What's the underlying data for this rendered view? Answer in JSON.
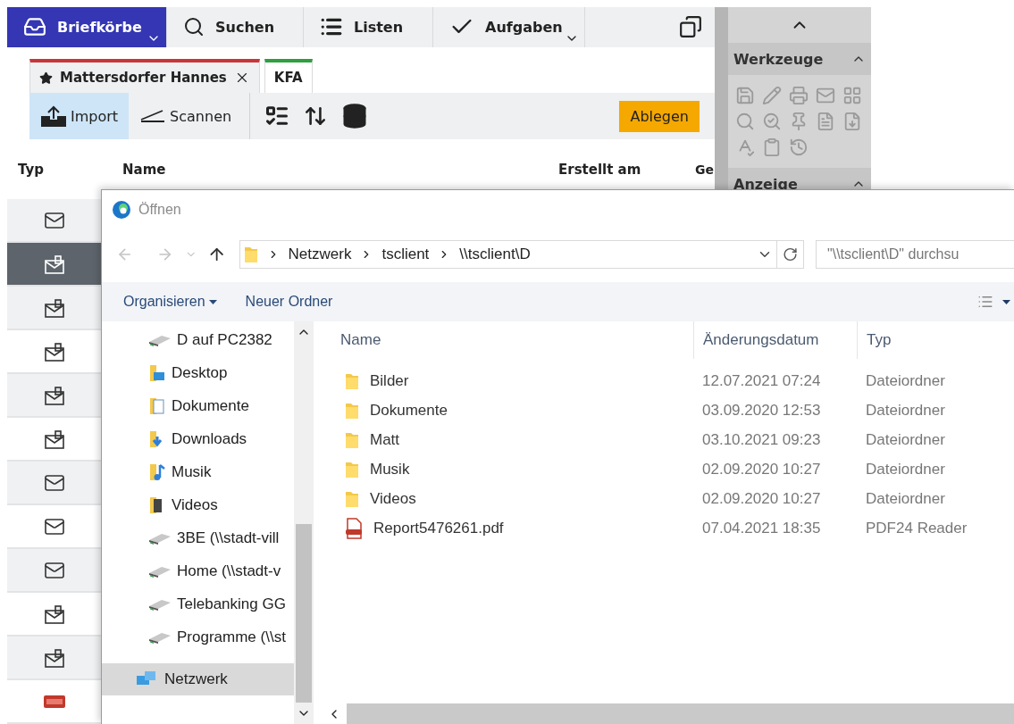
{
  "top_nav": {
    "items": [
      {
        "label": "Briefkörbe",
        "kind": "inbox",
        "dropdown": true,
        "selected": true
      },
      {
        "label": "Suchen",
        "kind": "search",
        "dropdown": false,
        "selected": false
      },
      {
        "label": "Listen",
        "kind": "list",
        "dropdown": false,
        "selected": false
      },
      {
        "label": "Aufgaben",
        "kind": "check",
        "dropdown": true,
        "selected": false
      }
    ]
  },
  "tabs": [
    {
      "label": "Mattersdorfer Hannes",
      "starred": true,
      "closable": true,
      "color": "#c8363a",
      "selected": true
    },
    {
      "label": "KFA",
      "starred": false,
      "closable": false,
      "color": "#2e9e3e",
      "selected": false
    }
  ],
  "toolbar": {
    "buttons": [
      {
        "label": "Import",
        "kind": "import",
        "selected": true
      },
      {
        "label": "Scannen",
        "kind": "scan",
        "selected": false
      }
    ],
    "primary": "Ablegen"
  },
  "table": {
    "columns": [
      "Typ",
      "Name",
      "Erstellt am",
      "Ge"
    ],
    "rows": [
      {
        "kind": "mail",
        "selected": false
      },
      {
        "kind": "attachment",
        "selected": true
      },
      {
        "kind": "attachment",
        "selected": false
      },
      {
        "kind": "attachment",
        "selected": false
      },
      {
        "kind": "attachment",
        "selected": false
      },
      {
        "kind": "attachment",
        "selected": false
      },
      {
        "kind": "mail",
        "selected": false
      },
      {
        "kind": "mail",
        "selected": false
      },
      {
        "kind": "mail",
        "selected": false
      },
      {
        "kind": "attachment",
        "selected": false
      },
      {
        "kind": "attachment",
        "selected": false
      },
      {
        "kind": "pdf",
        "selected": false
      }
    ]
  },
  "tools_panel": {
    "sections": [
      {
        "title": "Werkzeuge",
        "expanded": true
      },
      {
        "title": "Anzeige",
        "expanded": true
      }
    ]
  },
  "dialog": {
    "title": "Öffnen",
    "breadcrumbs": [
      "Netzwerk",
      "tsclient",
      "\\\\tsclient\\D"
    ],
    "search": {
      "placeholder": "\"\\\\tsclient\\D\" durchsu"
    },
    "commands": [
      {
        "label": "Organisieren",
        "dropdown": true
      },
      {
        "label": "Neuer Ordner",
        "dropdown": false
      }
    ],
    "nav_pane": {
      "items": [
        {
          "label": "D auf PC2382",
          "kind": "drive"
        },
        {
          "label": "Desktop",
          "kind": "desktop"
        },
        {
          "label": "Dokumente",
          "kind": "documents"
        },
        {
          "label": "Downloads",
          "kind": "downloads"
        },
        {
          "label": "Musik",
          "kind": "music"
        },
        {
          "label": "Videos",
          "kind": "videos"
        },
        {
          "label": "3BE (\\\\stadt-vill",
          "kind": "drive"
        },
        {
          "label": "Home (\\\\stadt-v",
          "kind": "drive"
        },
        {
          "label": "Telebanking GG",
          "kind": "drive"
        },
        {
          "label": "Programme (\\\\st",
          "kind": "drive"
        }
      ],
      "network": {
        "label": "Netzwerk",
        "selected": true
      }
    },
    "files": {
      "columns": [
        "Name",
        "Änderungsdatum",
        "Typ"
      ],
      "rows": [
        {
          "name": "Bilder",
          "kind": "folder",
          "modified": "12.07.2021 07:24",
          "type": "Dateiordner"
        },
        {
          "name": "Dokumente",
          "kind": "folder",
          "modified": "03.09.2020 12:53",
          "type": "Dateiordner"
        },
        {
          "name": "Matt",
          "kind": "folder",
          "modified": "03.10.2021 09:23",
          "type": "Dateiordner"
        },
        {
          "name": "Musik",
          "kind": "folder",
          "modified": "02.09.2020 10:27",
          "type": "Dateiordner"
        },
        {
          "name": "Videos",
          "kind": "folder",
          "modified": "02.09.2020 10:27",
          "type": "Dateiordner"
        },
        {
          "name": "Report5476261.pdf",
          "kind": "pdf",
          "modified": "07.04.2021 18:35",
          "type": "PDF24 Reader"
        }
      ]
    }
  }
}
